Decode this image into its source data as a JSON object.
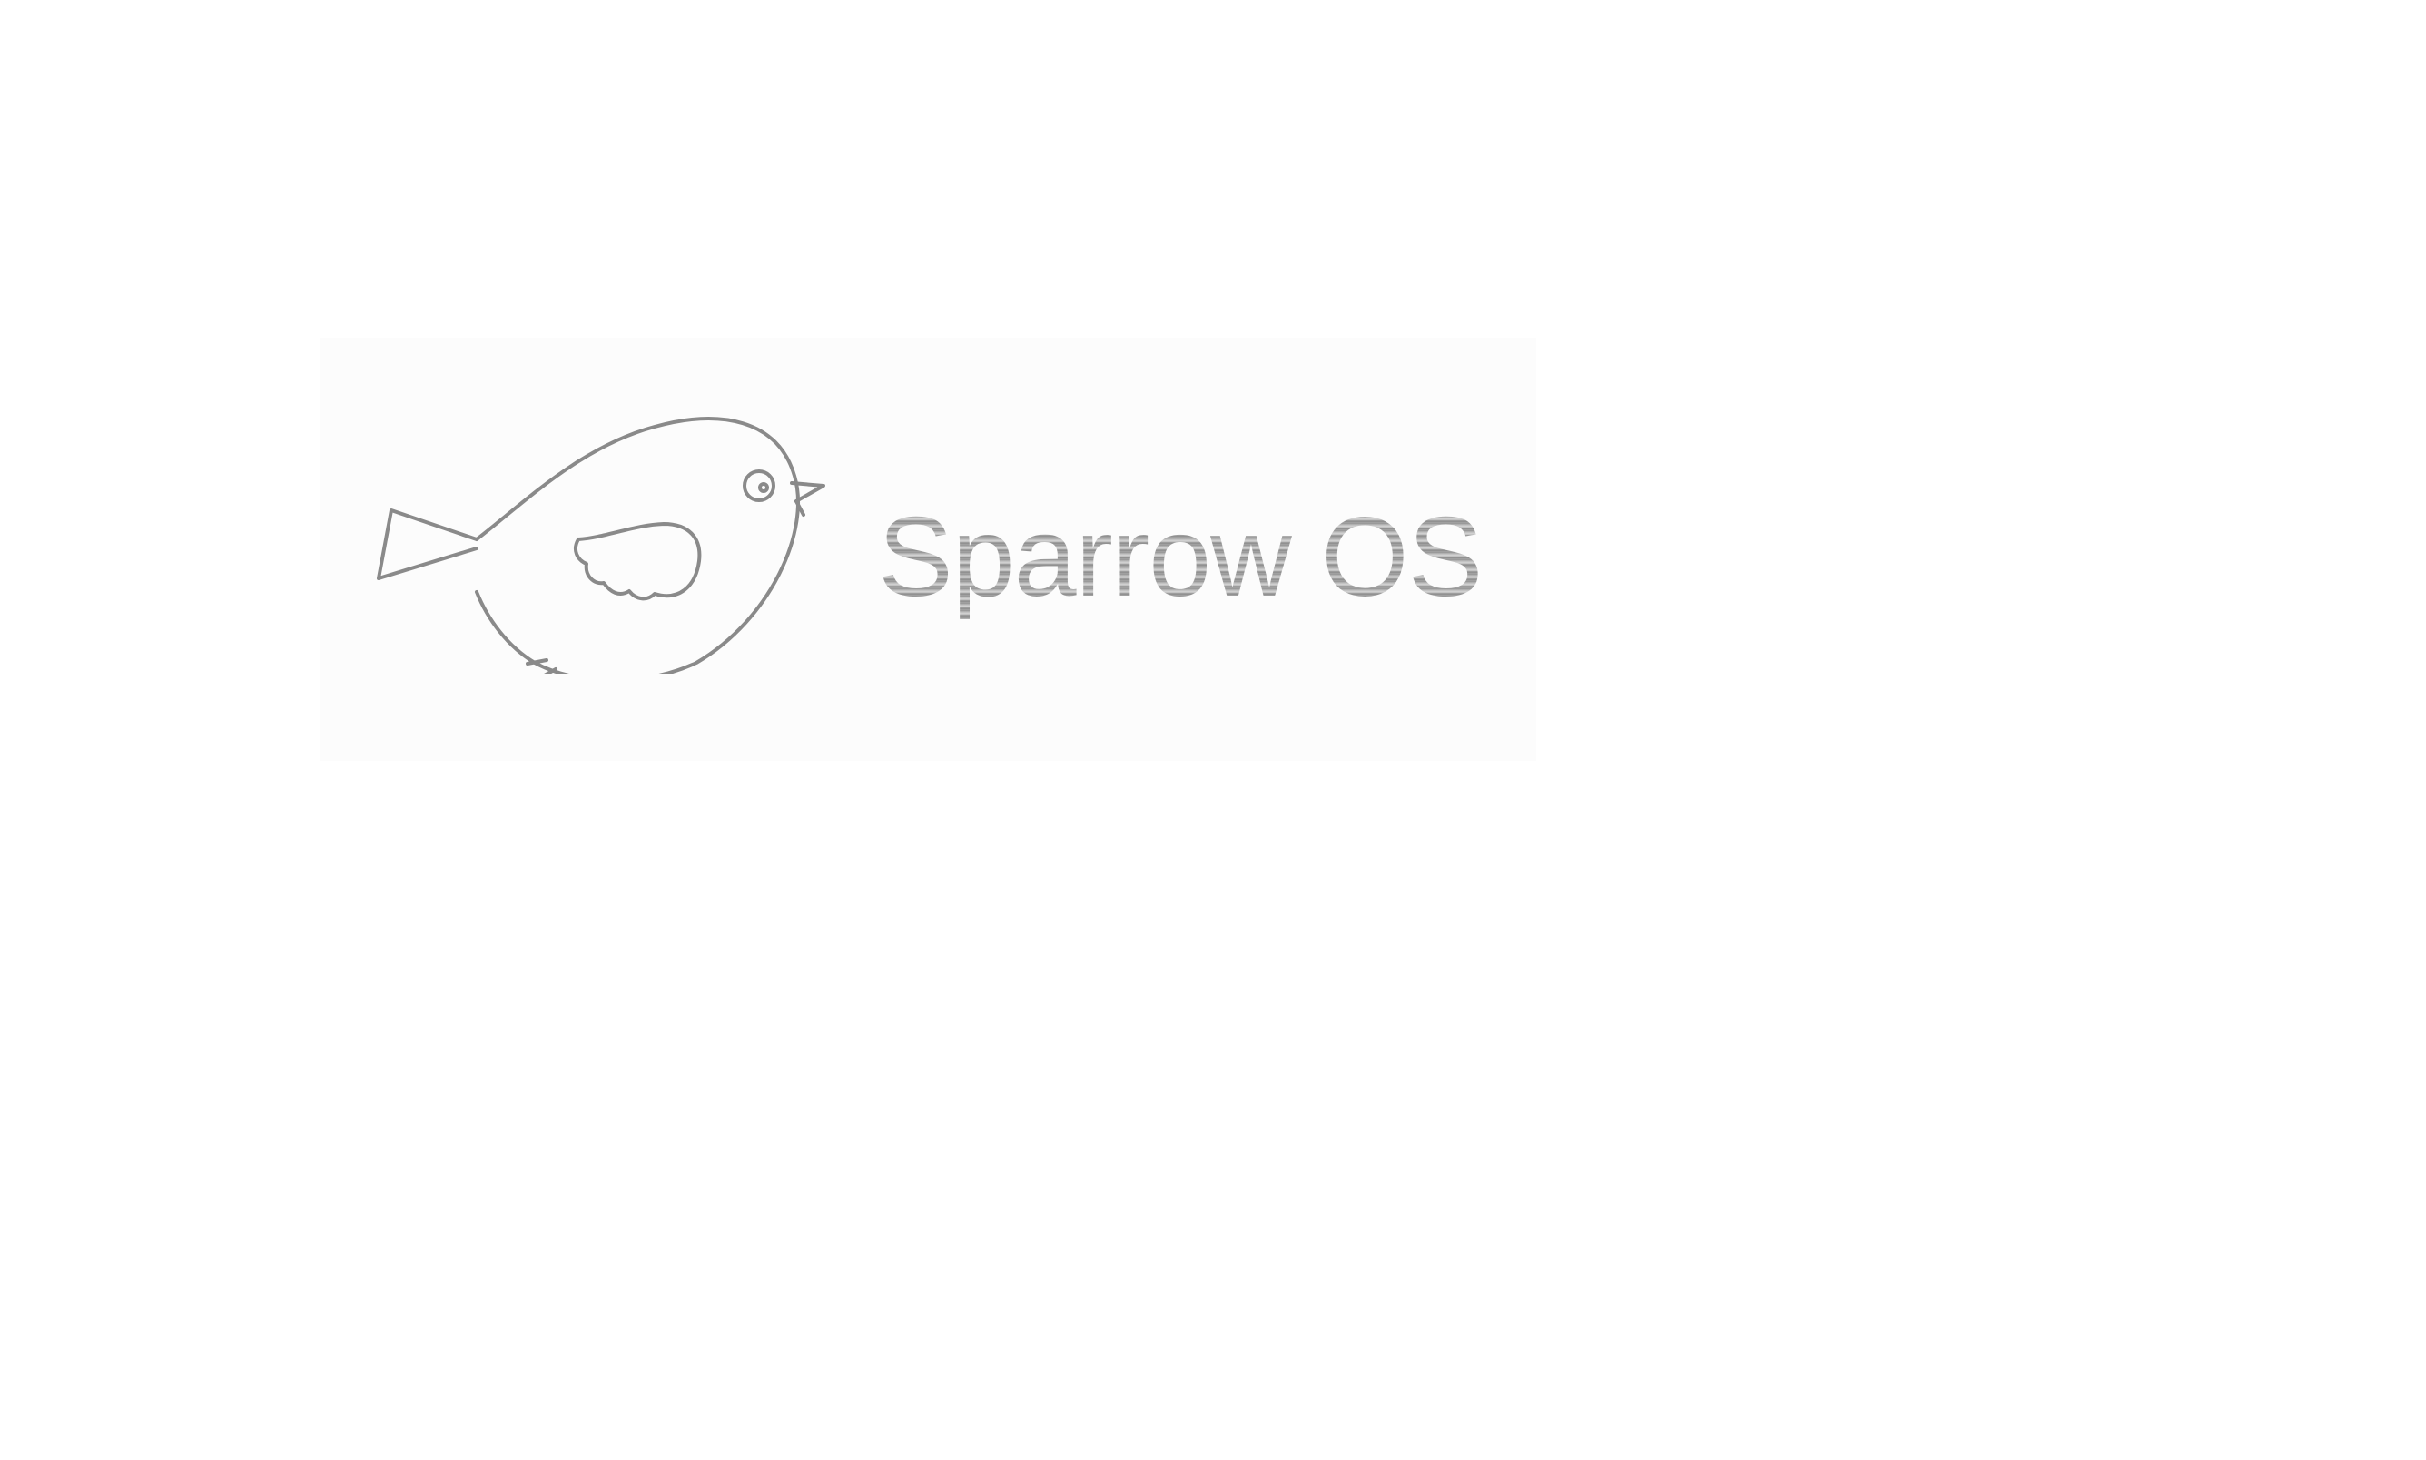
{
  "logo": {
    "brand_name": "Sparrow OS",
    "icon": "sparrow-bird-icon",
    "stroke_color": "#8a8a8a",
    "text_color": "#9a9a9a",
    "background_color": "#ffffff"
  }
}
